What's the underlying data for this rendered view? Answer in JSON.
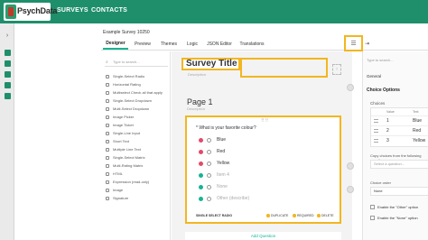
{
  "topbar": {
    "logo_text": "PsychData",
    "logo_sub": "",
    "nav": [
      "SURVEYS",
      "CONTACTS"
    ]
  },
  "survey": {
    "name": "Example Survey 10250"
  },
  "tabs": [
    "Designer",
    "Preview",
    "Themes",
    "Logic",
    "JSON Editor",
    "Translations"
  ],
  "toolbox": {
    "search_placeholder": "Type to search...",
    "items": [
      "Single-Select Radio",
      "Horizontal Rating",
      "Multiselect Check all that apply",
      "Single-Select Dropdown",
      "Multi-Select Dropdown",
      "Image Picker",
      "Image Ticket",
      "Single-Line Input",
      "Short Text",
      "Multiple Line Text",
      "Single-Select Matrix",
      "Multi-Rating Matrix",
      "HTML",
      "Expression (read-only)",
      "Image",
      "Signature"
    ]
  },
  "canvas": {
    "survey_title": "Survey Title",
    "survey_description": "Description",
    "page_title": "Page 1",
    "page_description": "Description",
    "question": {
      "title": "* What is your favorite colour?",
      "choices": [
        {
          "label": "Blue",
          "ghost": false
        },
        {
          "label": "Red",
          "ghost": false
        },
        {
          "label": "Yellow",
          "ghost": false
        },
        {
          "label": "Item 4",
          "ghost": true
        },
        {
          "label": "None",
          "ghost": true
        },
        {
          "label": "Other (describe)",
          "ghost": true
        }
      ],
      "type": "SINGLE SELECT RADIO",
      "actions": [
        "DUPLICATE",
        "REQUIRED",
        "DELETE"
      ]
    },
    "add_question": "Add Question"
  },
  "properties": {
    "search_placeholder": "Type to search...",
    "general": "General",
    "section": "Choice Options",
    "choices_label": "Choices",
    "columns": [
      "Value",
      "Text"
    ],
    "rows": [
      {
        "value": "1",
        "text": "Blue"
      },
      {
        "value": "2",
        "text": "Red"
      },
      {
        "value": "3",
        "text": "Yellow"
      }
    ],
    "copy_label": "Copy choices from the following question",
    "copy_placeholder": "Select a question...",
    "order_label": "Choice order",
    "order_value": "None",
    "other_label": "Enable the \"Other\" option",
    "none_label": "Enable the \"None\" option"
  },
  "colors": {
    "brand": "#1f8f6b",
    "accent": "#19b394",
    "highlight": "#f2b620",
    "delete": "#e34a6a"
  }
}
